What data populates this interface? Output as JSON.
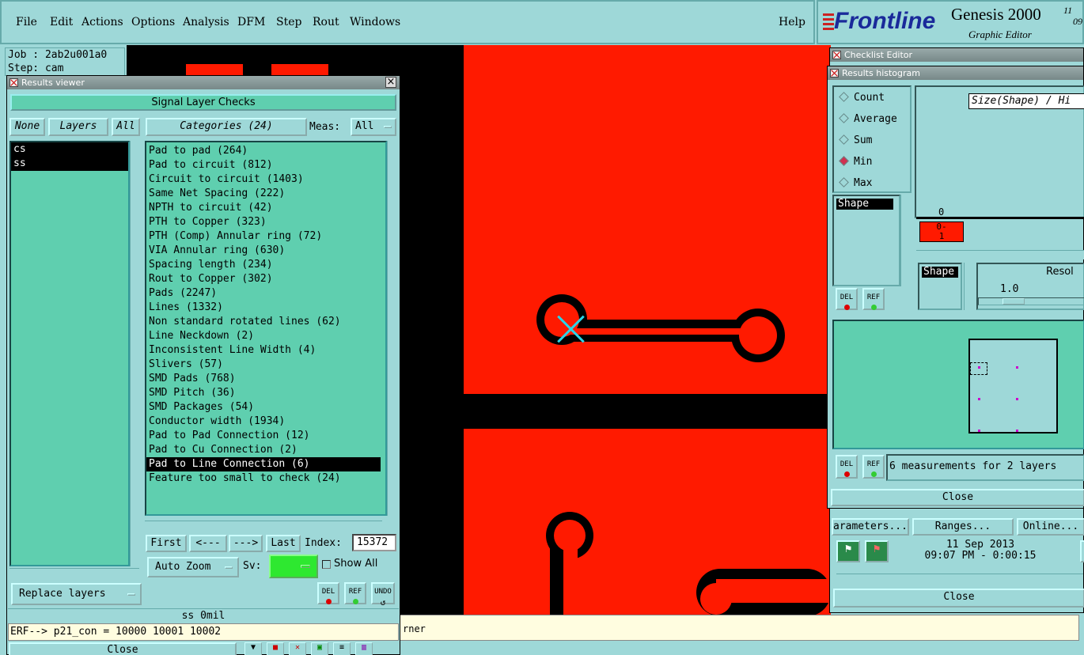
{
  "menubar": {
    "items": [
      "File",
      "Edit",
      "Actions",
      "Options",
      "Analysis",
      "DFM",
      "Step",
      "Rout",
      "Windows"
    ],
    "help": "Help"
  },
  "logo": {
    "brand": "Frontline",
    "product": "Genesis 2000",
    "subtitle": "Graphic Editor",
    "corner1": "11",
    "corner2": "09"
  },
  "job": {
    "job": "Job : 2ab2u001a0",
    "step": "Step: cam"
  },
  "results_viewer": {
    "title": "Results viewer",
    "header": "Signal Layer Checks",
    "none": "None",
    "layers": "Layers",
    "all": "All",
    "categories_btn": "Categories (24)",
    "meas_label": "Meas:",
    "meas_value": "All",
    "layer_list": [
      "cs",
      "ss"
    ],
    "categories": [
      "Pad to pad (264)",
      "Pad to circuit (812)",
      "Circuit to circuit (1403)",
      "Same Net Spacing (222)",
      "NPTH to circuit (42)",
      "PTH to Copper (323)",
      "PTH (Comp) Annular ring (72)",
      "VIA Annular ring (630)",
      "Spacing length (234)",
      "Rout to Copper (302)",
      "Pads (2247)",
      "Lines (1332)",
      "Non standard rotated lines (62)",
      "Line Neckdown (2)",
      "Inconsistent Line Width (4)",
      "Slivers (57)",
      "SMD Pads (768)",
      "SMD Pitch (36)",
      "SMD Packages (54)",
      "Conductor width (1934)",
      "Pad to Pad Connection (12)",
      "Pad to Cu Connection (2)",
      "Pad to Line Connection (6)",
      "Feature too small to check (24)"
    ],
    "selected_index": 22,
    "first": "First",
    "prev": "<---",
    "next": "--->",
    "last": "Last",
    "index_label": "Index:",
    "index_value": "15372",
    "auto_zoom": "Auto Zoom",
    "sv_label": "Sv:",
    "show_all": "Show All",
    "replace_layers": "Replace layers",
    "del": "DEL",
    "ref": "REF",
    "undo": "UNDO",
    "status": "ss 0mil",
    "erf": "ERF--> p21_con = 10000 10001 10002",
    "close": "Close"
  },
  "message_bar": {
    "text": "rner"
  },
  "checklist_editor": {
    "title": "Checklist Editor",
    "params": "arameters...",
    "ranges": "Ranges...",
    "online": "Online...",
    "date": "11 Sep 2013",
    "time": "09:07 PM - 0:00:15",
    "close": "Close"
  },
  "histogram": {
    "title": "Results histogram",
    "options": [
      "Count",
      "Average",
      "Sum",
      "Min",
      "Max"
    ],
    "selected": "Min",
    "size_label": "Size(Shape) / Hi",
    "shape_list": [
      "Shape"
    ],
    "shape_list2": [
      "Shape"
    ],
    "zero": "0",
    "bin_label": "0-\n1",
    "resol_label": "Resol",
    "resol_value": "1.0",
    "measurements": "6 measurements for 2 layers",
    "close": "Close",
    "del": "DEL",
    "ref": "REF"
  },
  "colors": {
    "copper": "#ff1a00",
    "bg": "#9ed8d8",
    "list": "#5fcfaf",
    "marker": "#2ad4e8"
  }
}
